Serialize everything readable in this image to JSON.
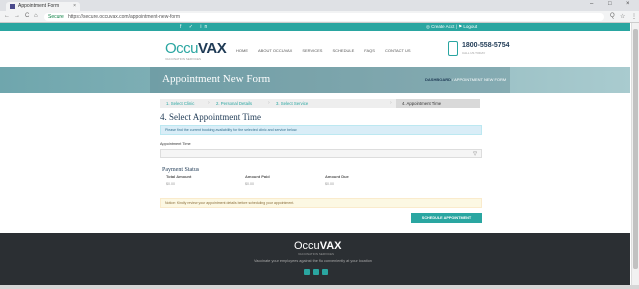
{
  "browser": {
    "tab_title": "Appointment Form",
    "tab_close": "×",
    "url_secure": "Secure",
    "url": "https://secure.occuvax.com/appointment-new-form",
    "back": "←",
    "forward": "→",
    "reload": "C",
    "home": "⌂",
    "zoom_icon": "Q",
    "star_icon": "☆",
    "menu_icon": "⋮",
    "win_min": "–",
    "win_max": "□",
    "win_close": "×"
  },
  "topbar": {
    "social": "f  ✓  in",
    "account": "◎ Create Acct | ⚑ Logout"
  },
  "header": {
    "logo_occu": "Occu",
    "logo_vax": "VAX",
    "logo_sub": "VACCINATION SERVICES",
    "nav": [
      "HOME",
      "ABOUT OCCUVAX",
      "SERVICES",
      "SCHEDULE",
      "FAQS",
      "CONTACT US"
    ],
    "phone": "1800-558-5754",
    "phone_sub": "CALL US TODAY"
  },
  "hero": {
    "title": "Appointment New Form",
    "crumb_home": "DASHBOARD",
    "crumb_current": " / APPOINTMENT NEW FORM"
  },
  "steps": {
    "items": [
      "1. Select Clinic",
      "2. Personal Details",
      "3. Select Service",
      "4. Appointment Time"
    ],
    "separator": "›"
  },
  "form": {
    "section_title": "4. Select Appointment Time",
    "info": "Please find the current booking availability for the selected clinic and service below.",
    "field_label": "Appointment Time",
    "select_arrow": "▽",
    "payment_title": "Payment Status",
    "payment_cols": [
      {
        "header": "Total Amount",
        "value": "$0.00"
      },
      {
        "header": "Amount Paid",
        "value": "$0.00"
      },
      {
        "header": "Amount Due",
        "value": "$0.00"
      }
    ],
    "warning": "Notice: Kindly review your appointment details before scheduling your appointment.",
    "schedule_button": "SCHEDULE APPOINTMENT"
  },
  "footer": {
    "logo_occu": "Occu",
    "logo_vax": "VAX",
    "logo_sub": "VACCINATION SERVICES",
    "tagline": "Vaccinate your employees against the flu conveniently at your location"
  },
  "colors": {
    "accent": "#2aa6a1",
    "navy": "#1f3a55",
    "footer_bg": "#2b2f33"
  }
}
